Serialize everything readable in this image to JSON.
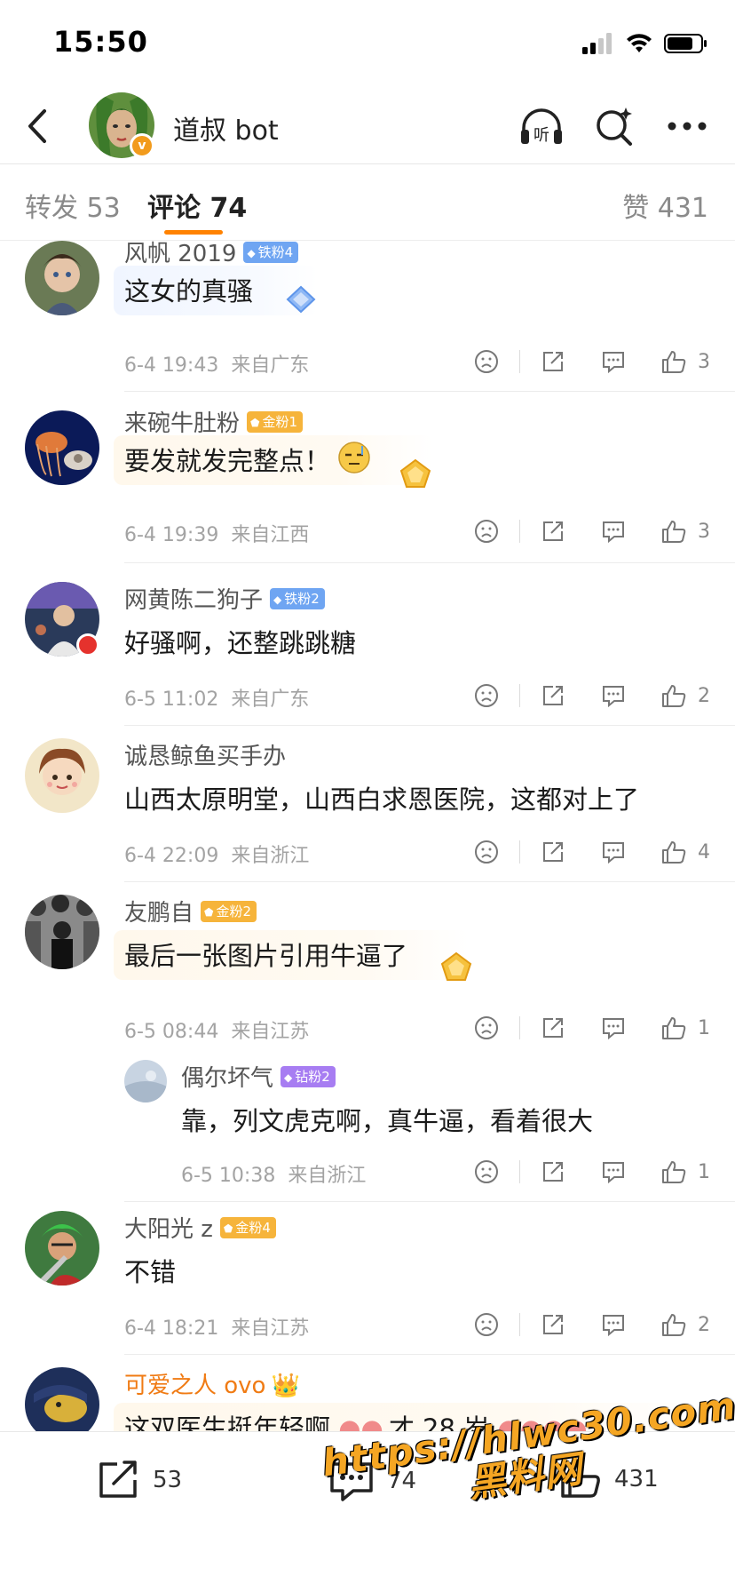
{
  "status_bar": {
    "time": "15:50"
  },
  "header": {
    "title": "道叔 bot",
    "verified_badge": "v",
    "listen_label": "听"
  },
  "tabs": [
    {
      "label": "转发 53"
    },
    {
      "label": "评论 74"
    },
    {
      "label": "赞 431"
    }
  ],
  "comments": [
    {
      "user": "风帆 2019",
      "badge": "铁粉4",
      "badge_type": "iron",
      "text": "这女的真骚",
      "time": "6-4 19:43",
      "location": "来自广东",
      "likes": "3"
    },
    {
      "user": "来碗牛肚粉",
      "badge": "金粉1",
      "badge_type": "gold",
      "text": "要发就发完整点！",
      "time": "6-4 19:39",
      "location": "来自江西",
      "likes": "3"
    },
    {
      "user": "网黄陈二狗子",
      "badge": "铁粉2",
      "badge_type": "iron",
      "text": "好骚啊，还整跳跳糖",
      "time": "6-5 11:02",
      "location": "来自广东",
      "likes": "2"
    },
    {
      "user": "诚恳鲸鱼买手办",
      "badge": "",
      "badge_type": "",
      "text": "山西太原明堂，山西白求恩医院，这都对上了",
      "time": "6-4 22:09",
      "location": "来自浙江",
      "likes": "4"
    },
    {
      "user": "友鹏自",
      "badge": "金粉2",
      "badge_type": "gold",
      "text": "最后一张图片引用牛逼了",
      "time": "6-5 08:44",
      "location": "来自江苏",
      "likes": "1"
    },
    {
      "user": "偶尔坏气",
      "badge": "钻粉2",
      "badge_type": "diamond",
      "text": "靠，列文虎克啊，真牛逼，看着很大",
      "time": "6-5 10:38",
      "location": "来自浙江",
      "likes": "1"
    },
    {
      "user": "大阳光 z",
      "badge": "金粉4",
      "badge_type": "gold",
      "text": "不错",
      "time": "6-4 18:21",
      "location": "来自江苏",
      "likes": "2"
    },
    {
      "user": "可爱之人 ovo",
      "badge": "",
      "badge_type": "",
      "text": "这双医生挺年轻啊",
      "text_tail": "才 28 岁",
      "time": "",
      "location": "",
      "likes": ""
    }
  ],
  "bottom_bar": {
    "repost_count": "53",
    "comment_count": "74",
    "like_count": "431"
  },
  "watermark": {
    "line1": "https://hlwc30.com",
    "line2": "黑料网"
  },
  "colors": {
    "accent": "#ff8200",
    "gold_badge": "#f6b43b",
    "iron_badge": "#6fa5f2",
    "diamond_badge": "#a77df2"
  }
}
